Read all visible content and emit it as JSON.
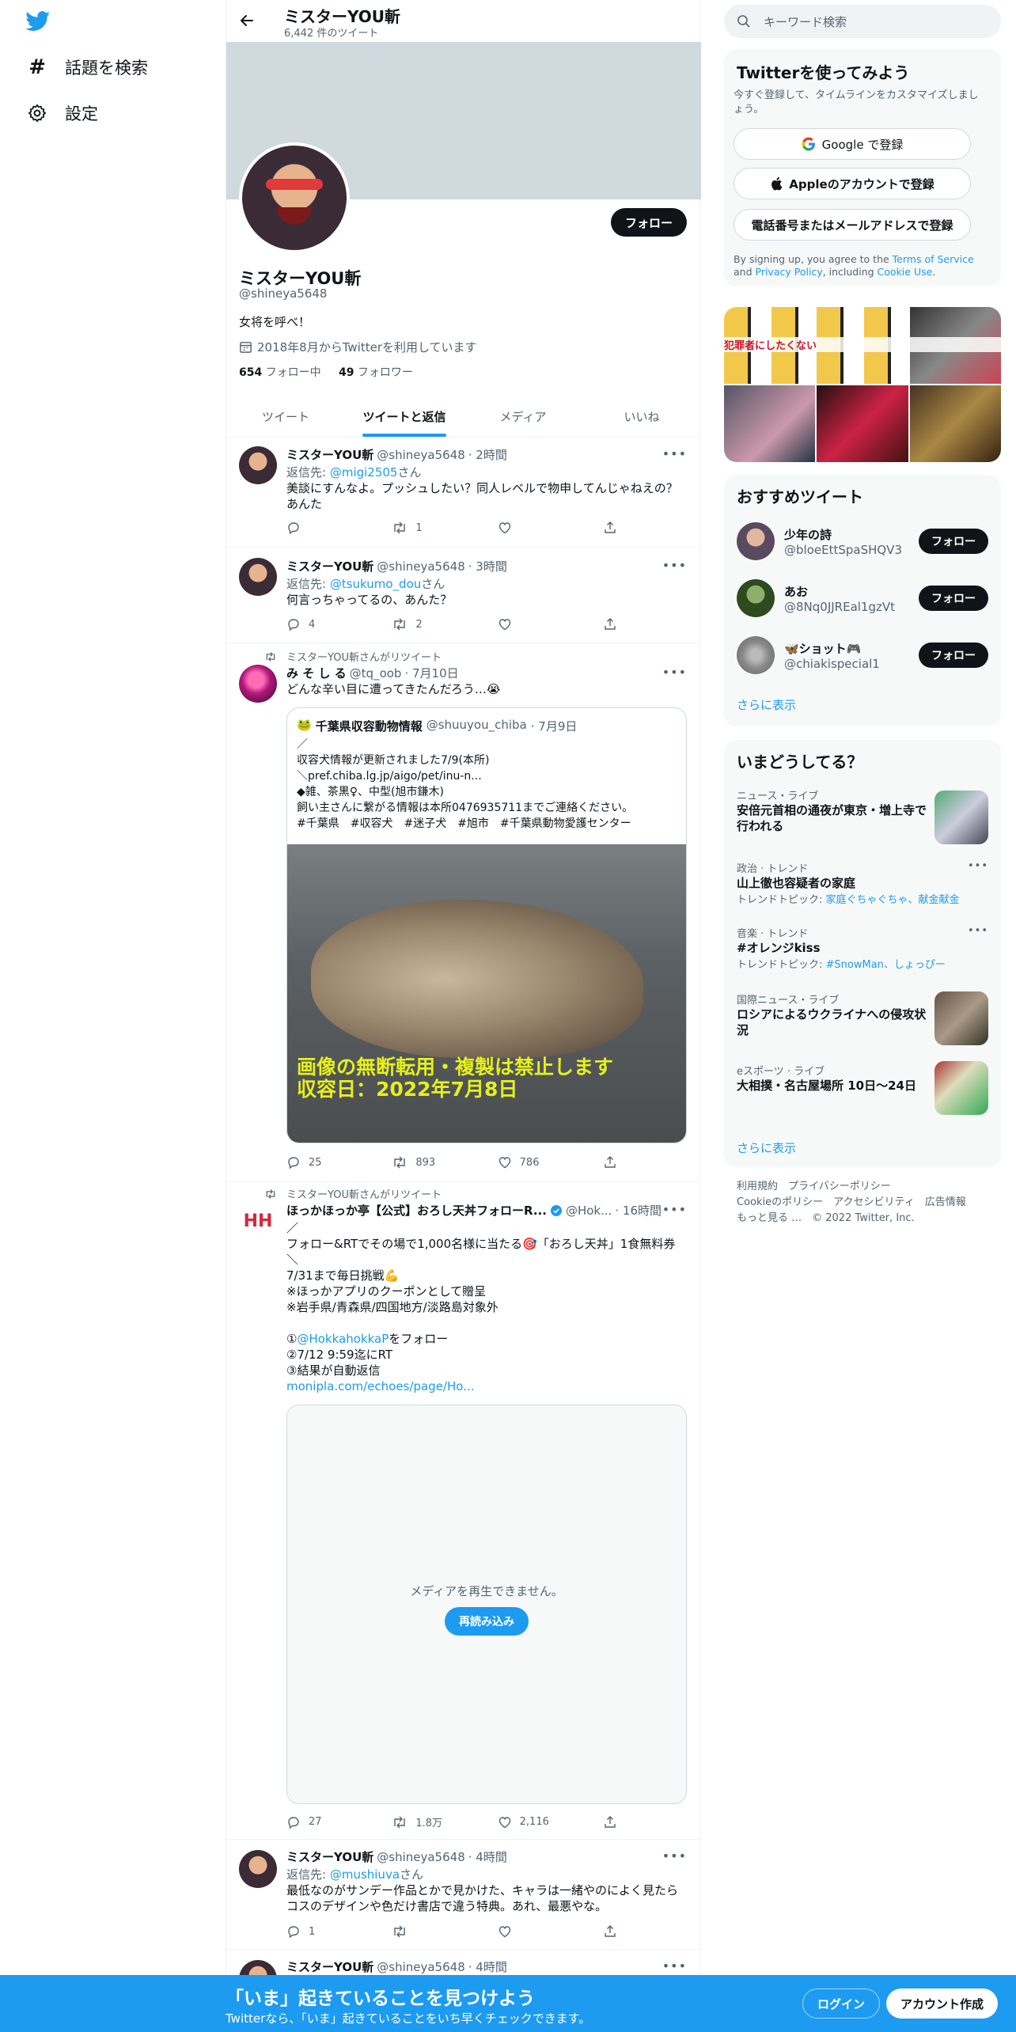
{
  "nav": {
    "explore": "話題を検索",
    "settings": "設定"
  },
  "header": {
    "name": "ミスターYOU斬",
    "tweet_count": "6,442 件のツイート"
  },
  "profile": {
    "follow_button": "フォロー",
    "name": "ミスターYOU斬",
    "handle": "@shineya5648",
    "bio": "女将を呼べ！",
    "joined": "2018年8月からTwitterを利用しています",
    "following_count": "654",
    "following_label": "フォロー中",
    "followers_count": "49",
    "followers_label": "フォロワー"
  },
  "tabs": [
    "ツイート",
    "ツイートと返信",
    "メディア",
    "いいね"
  ],
  "tweets": [
    {
      "name": "ミスターYOU斬",
      "handle": "@shineya5648",
      "time": "· 2時間",
      "reply_prefix": "返信先: ",
      "reply_to": "@migi2505",
      "reply_suffix": "さん",
      "text": "美談にすんなよ。プッシュしたい？同人レベルで物申してんじゃねえの？あんた",
      "replies": "",
      "retweets": "1",
      "likes": ""
    },
    {
      "name": "ミスターYOU斬",
      "handle": "@shineya5648",
      "time": "· 3時間",
      "reply_prefix": "返信先: ",
      "reply_to": "@tsukumo_dou",
      "reply_suffix": "さん",
      "text": "何言っちゃってるの、あんた？",
      "replies": "4",
      "retweets": "2",
      "likes": ""
    },
    {
      "rt_label": "ミスターYOU斬さんがリツイート",
      "name": "み そ し る",
      "handle": "@tq_oob",
      "time": "· 7月10日",
      "text": "どんな辛い目に遭ってきたんだろう…😭",
      "quote": {
        "emoji": "🐸",
        "name": "千葉県収容動物情報",
        "handle": "@shuuyou_chiba",
        "time": "· 7月9日",
        "lines": [
          "／",
          "収容犬情報が更新されました7/9(本所)",
          "＼pref.chiba.lg.jp/aigo/pet/inu-n...",
          "◆雑、茶黒♀、中型(旭市鎌木)",
          "飼い主さんに繋がる情報は本所0476935711までご連絡ください。",
          "#千葉県　#収容犬　#迷子犬　#旭市　#千葉県動物愛護センター"
        ],
        "image_caption": [
          "画像の無断転用・複製は禁止します",
          "収容日：2022年7月8日"
        ]
      },
      "replies": "25",
      "retweets": "893",
      "likes": "786"
    },
    {
      "rt_label": "ミスターYOU斬さんがリツイート",
      "avatar_text": "HH",
      "name": "ほっかほっか亭【公式】おろし天丼フォローR...",
      "handle": "@Hok...",
      "time": "· 16時間",
      "lines": [
        "／",
        "フォロー&RTでその場で1,000名様に当たる🎯「おろし天丼」1食無料券",
        "＼",
        "7/31まで毎日挑戦💪",
        "※ほっかアプリのクーポンとして贈呈",
        "※岩手県/青森県/四国地方/淡路島対象外",
        "",
        ""
      ],
      "line_mention": "@HokkahokkaP",
      "line_mention_prefix": "①",
      "line_mention_suffix": "をフォロー",
      "lines2": [
        "②7/12 9:59迄にRT",
        "③結果が自動返信"
      ],
      "link": "monipla.com/echoes/page/Ho...",
      "media_error": "メディアを再生できません。",
      "reload": "再読み込み",
      "replies": "27",
      "retweets": "1.8万",
      "likes": "2,116"
    },
    {
      "name": "ミスターYOU斬",
      "handle": "@shineya5648",
      "time": "· 4時間",
      "reply_prefix": "返信先: ",
      "reply_to": "@mushiuva",
      "reply_suffix": "さん",
      "text": "最低なのがサンデー作品とかで見かけた、キャラは一緒やのによく見たらコスのデザインや色だけ書店で違う特典。あれ、最悪やな。",
      "replies": "1",
      "retweets": "",
      "likes": ""
    },
    {
      "name": "ミスターYOU斬",
      "handle": "@shineya5648",
      "time": "· 4時間"
    }
  ],
  "sidebar": {
    "search_placeholder": "キーワード検索",
    "signup": {
      "title": "Twitterを使ってみよう",
      "subtitle": "今すぐ登録して、タイムラインをカスタマイズしましょう。",
      "google": "Google で登録",
      "apple": "Appleのアカウントで登録",
      "phone": "電話番号またはメールアドレスで登録",
      "terms_1": "By signing up, you agree to the ",
      "terms_link": "Terms of Service",
      "terms_2": " and ",
      "privacy_link": "Privacy Policy",
      "terms_3": ", including ",
      "cookie_link": "Cookie Use",
      "terms_4": "."
    },
    "media_banner_text": "犯罪者にしたくない",
    "recommended": {
      "title": "おすすめツイート",
      "users": [
        {
          "name": "少年の詩",
          "handle": "@bloeEttSpaSHQV3",
          "button": "フォロー"
        },
        {
          "name": "あお",
          "handle": "@8Nq0JJREal1gzVt",
          "button": "フォロー"
        },
        {
          "name": "🦋ショット🎮",
          "handle": "@chiakispecial1",
          "button": "フォロー"
        }
      ],
      "show_more": "さらに表示"
    },
    "trends": {
      "title": "いまどうしてる？",
      "items": [
        {
          "meta": "ニュース・ライブ",
          "title": "安倍元首相の通夜が東京・増上寺で行われる",
          "sub": "",
          "sub_link": ""
        },
        {
          "meta": "政治 · トレンド",
          "title": "山上徹也容疑者の家庭",
          "sub": "トレンドトピック: ",
          "sub_link": "家庭ぐちゃぐちゃ、献金献金"
        },
        {
          "meta": "音楽 · トレンド",
          "title": "#オレンジkiss",
          "sub": "トレンドトピック: ",
          "sub_link": "#SnowMan、しょっぴー"
        },
        {
          "meta": "国際ニュース・ライブ",
          "title": "ロシアによるウクライナへの侵攻状況",
          "sub": "",
          "sub_link": ""
        },
        {
          "meta": "eスポーツ · ライブ",
          "title": "大相撲・名古屋場所 10日〜24日",
          "sub": "",
          "sub_link": ""
        }
      ],
      "show_more": "さらに表示"
    },
    "footer": {
      "line1": "利用規約　プライバシーポリシー",
      "line2": "Cookieのポリシー　アクセシビリティ　広告情報",
      "line3": "もっと見る …　© 2022 Twitter, Inc."
    }
  },
  "bottom_bar": {
    "title": "「いま」起きていることを見つけよう",
    "subtitle": "Twitterなら、「いま」起きていることをいち早くチェックできます。",
    "login": "ログイン",
    "signup": "アカウント作成"
  },
  "colors": {
    "accent": "#1d9bf0",
    "text": "#0f1419",
    "secondary": "#536471"
  }
}
